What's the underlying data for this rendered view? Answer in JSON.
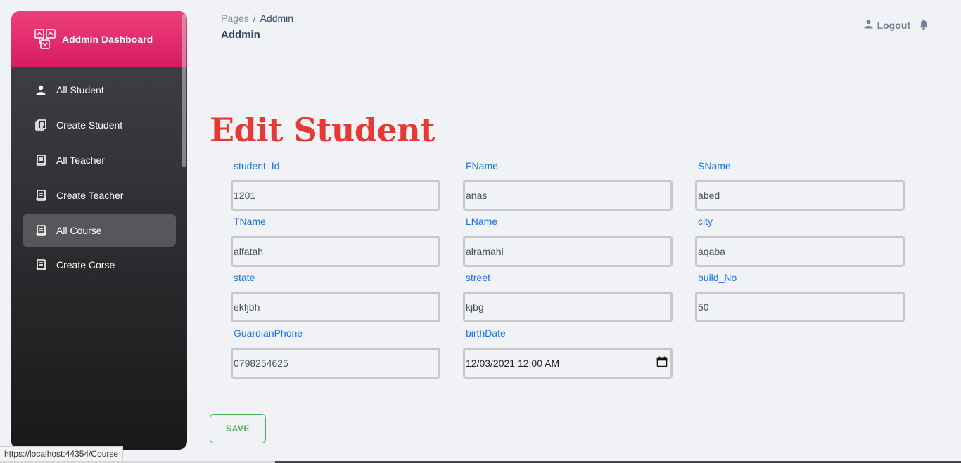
{
  "brand": {
    "title": "Addmin Dashboard"
  },
  "sidebar": {
    "items": [
      {
        "label": "All Student",
        "icon": "person-icon"
      },
      {
        "label": "Create Student",
        "icon": "form-icon"
      },
      {
        "label": "All Teacher",
        "icon": "receipt-icon"
      },
      {
        "label": "Create Teacher",
        "icon": "receipt-icon"
      },
      {
        "label": "All Course",
        "icon": "receipt-icon",
        "active": true
      },
      {
        "label": "Create Corse",
        "icon": "receipt-icon"
      }
    ]
  },
  "header": {
    "breadcrumb_root": "Pages",
    "breadcrumb_sep": "/",
    "breadcrumb_current": "Addmin",
    "page_title": "Addmin",
    "logout_label": "Logout"
  },
  "form": {
    "heading": "Edit Student",
    "fields": [
      {
        "label": "student_Id",
        "value": "1201"
      },
      {
        "label": "FName",
        "value": "anas"
      },
      {
        "label": "SName",
        "value": "abed"
      },
      {
        "label": "TName",
        "value": "alfatah"
      },
      {
        "label": "LName",
        "value": "alramahi"
      },
      {
        "label": "city",
        "value": "aqaba"
      },
      {
        "label": "state",
        "value": "ekfjbh"
      },
      {
        "label": "street",
        "value": "kjbg"
      },
      {
        "label": "build_No",
        "value": "50"
      },
      {
        "label": "GuardianPhone",
        "value": "0798254625"
      },
      {
        "label": "birthDate",
        "value": "12/03/2021 12:00  AM"
      }
    ],
    "save_label": "SAVE"
  },
  "status_bar": {
    "url": "https://localhost:44354/Course"
  },
  "colors": {
    "brand_pink": "#e91e63",
    "heading_red": "#e53935",
    "label_blue": "#1a73e8",
    "save_green": "#4caf50"
  }
}
